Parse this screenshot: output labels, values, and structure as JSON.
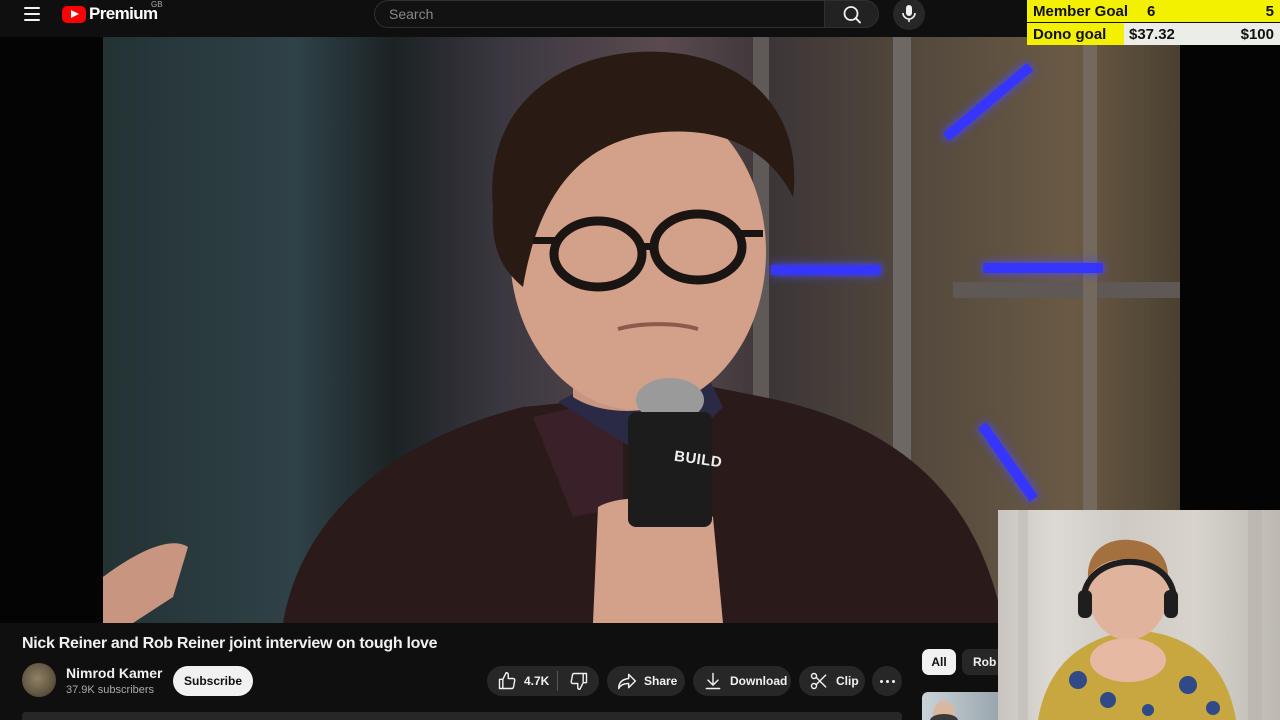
{
  "header": {
    "logo_text": "Premium",
    "region": "GB",
    "search_placeholder": "Search"
  },
  "goals": {
    "member": {
      "label": "Member Goal",
      "current": "6",
      "target": "5"
    },
    "dono": {
      "label": "Dono goal",
      "current": "$37.32",
      "target": "$100",
      "progress_fraction": 0.3732
    }
  },
  "video": {
    "title": "Nick Reiner and Rob Reiner joint interview on tough love",
    "mic_logo_text": "BUILD"
  },
  "channel": {
    "name": "Nimrod Kamer",
    "subscribers": "37.9K subscribers"
  },
  "actions": {
    "subscribe": "Subscribe",
    "like_count": "4.7K",
    "share": "Share",
    "download": "Download",
    "clip": "Clip"
  },
  "sidebar": {
    "chips": [
      "All",
      "Rob R"
    ]
  },
  "colors": {
    "brand_red": "#ff0000",
    "goal_yellow": "#f4f100",
    "background": "#0f0f0f"
  }
}
